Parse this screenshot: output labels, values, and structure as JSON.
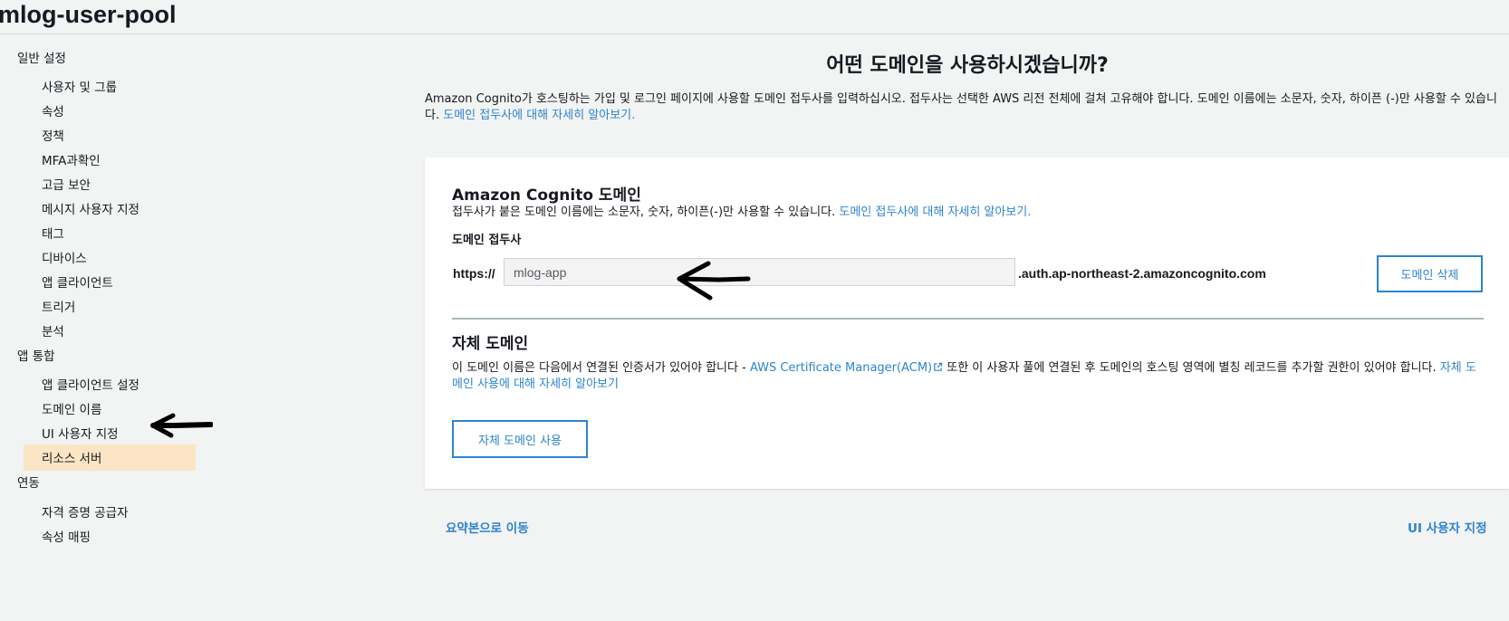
{
  "header": {
    "pool_name": "mlog-user-pool"
  },
  "sidebar": {
    "sections": [
      {
        "label": "일반 설정",
        "items": [
          {
            "label": "사용자 및 그룹"
          },
          {
            "label": "속성"
          },
          {
            "label": "정책"
          },
          {
            "label": "MFA과확인"
          },
          {
            "label": "고급 보안"
          },
          {
            "label": "메시지 사용자 지정"
          },
          {
            "label": "태그"
          },
          {
            "label": "디바이스"
          },
          {
            "label": "앱 클라이언트"
          },
          {
            "label": "트리거"
          },
          {
            "label": "분석"
          }
        ]
      },
      {
        "label": "앱 통합",
        "items": [
          {
            "label": "앱 클라이언트 설정"
          },
          {
            "label": "도메인 이름",
            "active": true
          },
          {
            "label": "UI 사용자 지정"
          },
          {
            "label": "리소스 서버"
          }
        ]
      },
      {
        "label": "연동",
        "items": [
          {
            "label": "자격 증명 공급자"
          },
          {
            "label": "속성 매핑"
          }
        ]
      }
    ]
  },
  "main": {
    "heading": "어떤 도메인을 사용하시겠습니까?",
    "intro_text": "Amazon Cognito가 호스팅하는 가입 및 로그인 페이지에 사용할 도메인 접두사를 입력하십시오. 접두사는 선택한 AWS 리전 전체에 걸쳐 고유해야 합니다. 도메인 이름에는 소문자, 숫자, 하이픈 (-)만 사용할 수 있습니다.",
    "intro_link": "도메인 접두사에 대해 자세히 알아보기.",
    "cognito_domain": {
      "title": "Amazon Cognito 도메인",
      "description": "접두사가 붙은 도메인 이름에는 소문자, 숫자, 하이픈(-)만 사용할 수 있습니다.",
      "learn_more_link": "도메인 접두사에 대해 자세히 알아보기.",
      "prefix_label": "도메인 접두사",
      "scheme": "https://",
      "prefix_value": "mlog-app",
      "domain_suffix": ".auth.ap-northeast-2.amazoncognito.com",
      "delete_button": "도메인 삭제"
    },
    "custom_domain": {
      "title": "자체 도메인",
      "description_before": "이 도메인 이름은 다음에서 연결된 인증서가 있어야 합니다 -",
      "acm_link": "AWS Certificate Manager(ACM)",
      "description_after": "또한 이 사용자 풀에 연결된 후 도메인의 호스팅 영역에 별칭 레코드를 추가할 권한이 있어야 합니다.",
      "learn_more_link": "자체 도메인 사용에 대해 자세히 알아보기",
      "use_button": "자체 도메인 사용"
    },
    "footer": {
      "back_link": "요약본으로 이동",
      "next_link": "UI 사용자 지정"
    }
  },
  "colors": {
    "link": "#2d84cf",
    "active_nav_bg": "#fbe5c4",
    "page_bg": "#f2f3f3",
    "annotation": "#000000"
  }
}
